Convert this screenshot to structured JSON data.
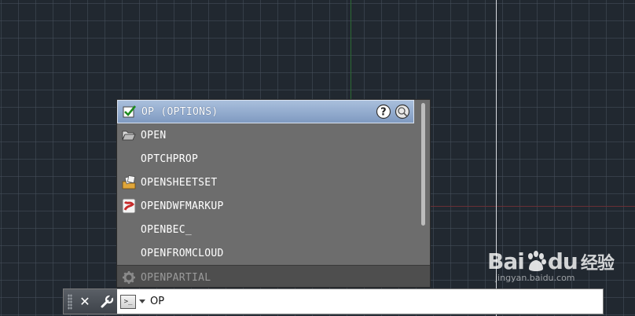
{
  "autocomplete": {
    "selected": {
      "label": "OP (OPTIONS)"
    },
    "items": [
      {
        "label": "OPEN",
        "icon": "folder-open-icon"
      },
      {
        "label": "OPTCHPROP",
        "icon": ""
      },
      {
        "label": "OPENSHEETSET",
        "icon": "sheetset-icon"
      },
      {
        "label": "OPENDWFMARKUP",
        "icon": "dwf-markup-icon"
      },
      {
        "label": "OPENBEC_",
        "icon": ""
      },
      {
        "label": "OPENFROMCLOUD",
        "icon": ""
      }
    ],
    "partial": {
      "label": "OPENPARTIAL",
      "icon": "gear-icon"
    }
  },
  "command_line": {
    "input_value": "OP"
  },
  "watermark": {
    "logo_text_1": "Bai",
    "logo_text_2": "du",
    "logo_text_3": "经验",
    "subtext": "jingyan.baidu.com"
  },
  "colors": {
    "canvas": "#212830",
    "selected_row": "#8ea8cc",
    "list_bg": "#6d6d6d"
  }
}
